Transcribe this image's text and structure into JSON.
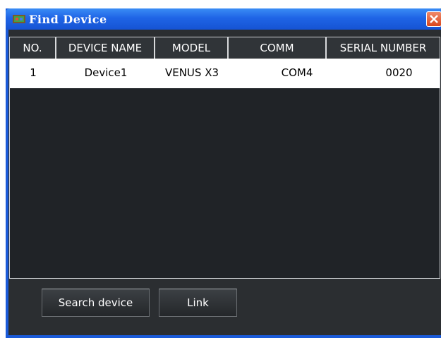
{
  "window": {
    "title": "Find Device"
  },
  "icons": {
    "app": "device-icon",
    "close": "close-icon"
  },
  "table": {
    "columns": [
      "NO.",
      "DEVICE NAME",
      "MODEL",
      "COMM",
      "SERIAL NUMBER"
    ],
    "rows": [
      [
        "1",
        "Device1",
        "VENUS X3",
        "COM4",
        "0020"
      ]
    ]
  },
  "buttons": {
    "search": "Search device",
    "link": "Link"
  },
  "colors": {
    "titlebar": "#1f64e6",
    "panel": "#2b2e31",
    "list": "#202327",
    "close": "#d9461c"
  }
}
